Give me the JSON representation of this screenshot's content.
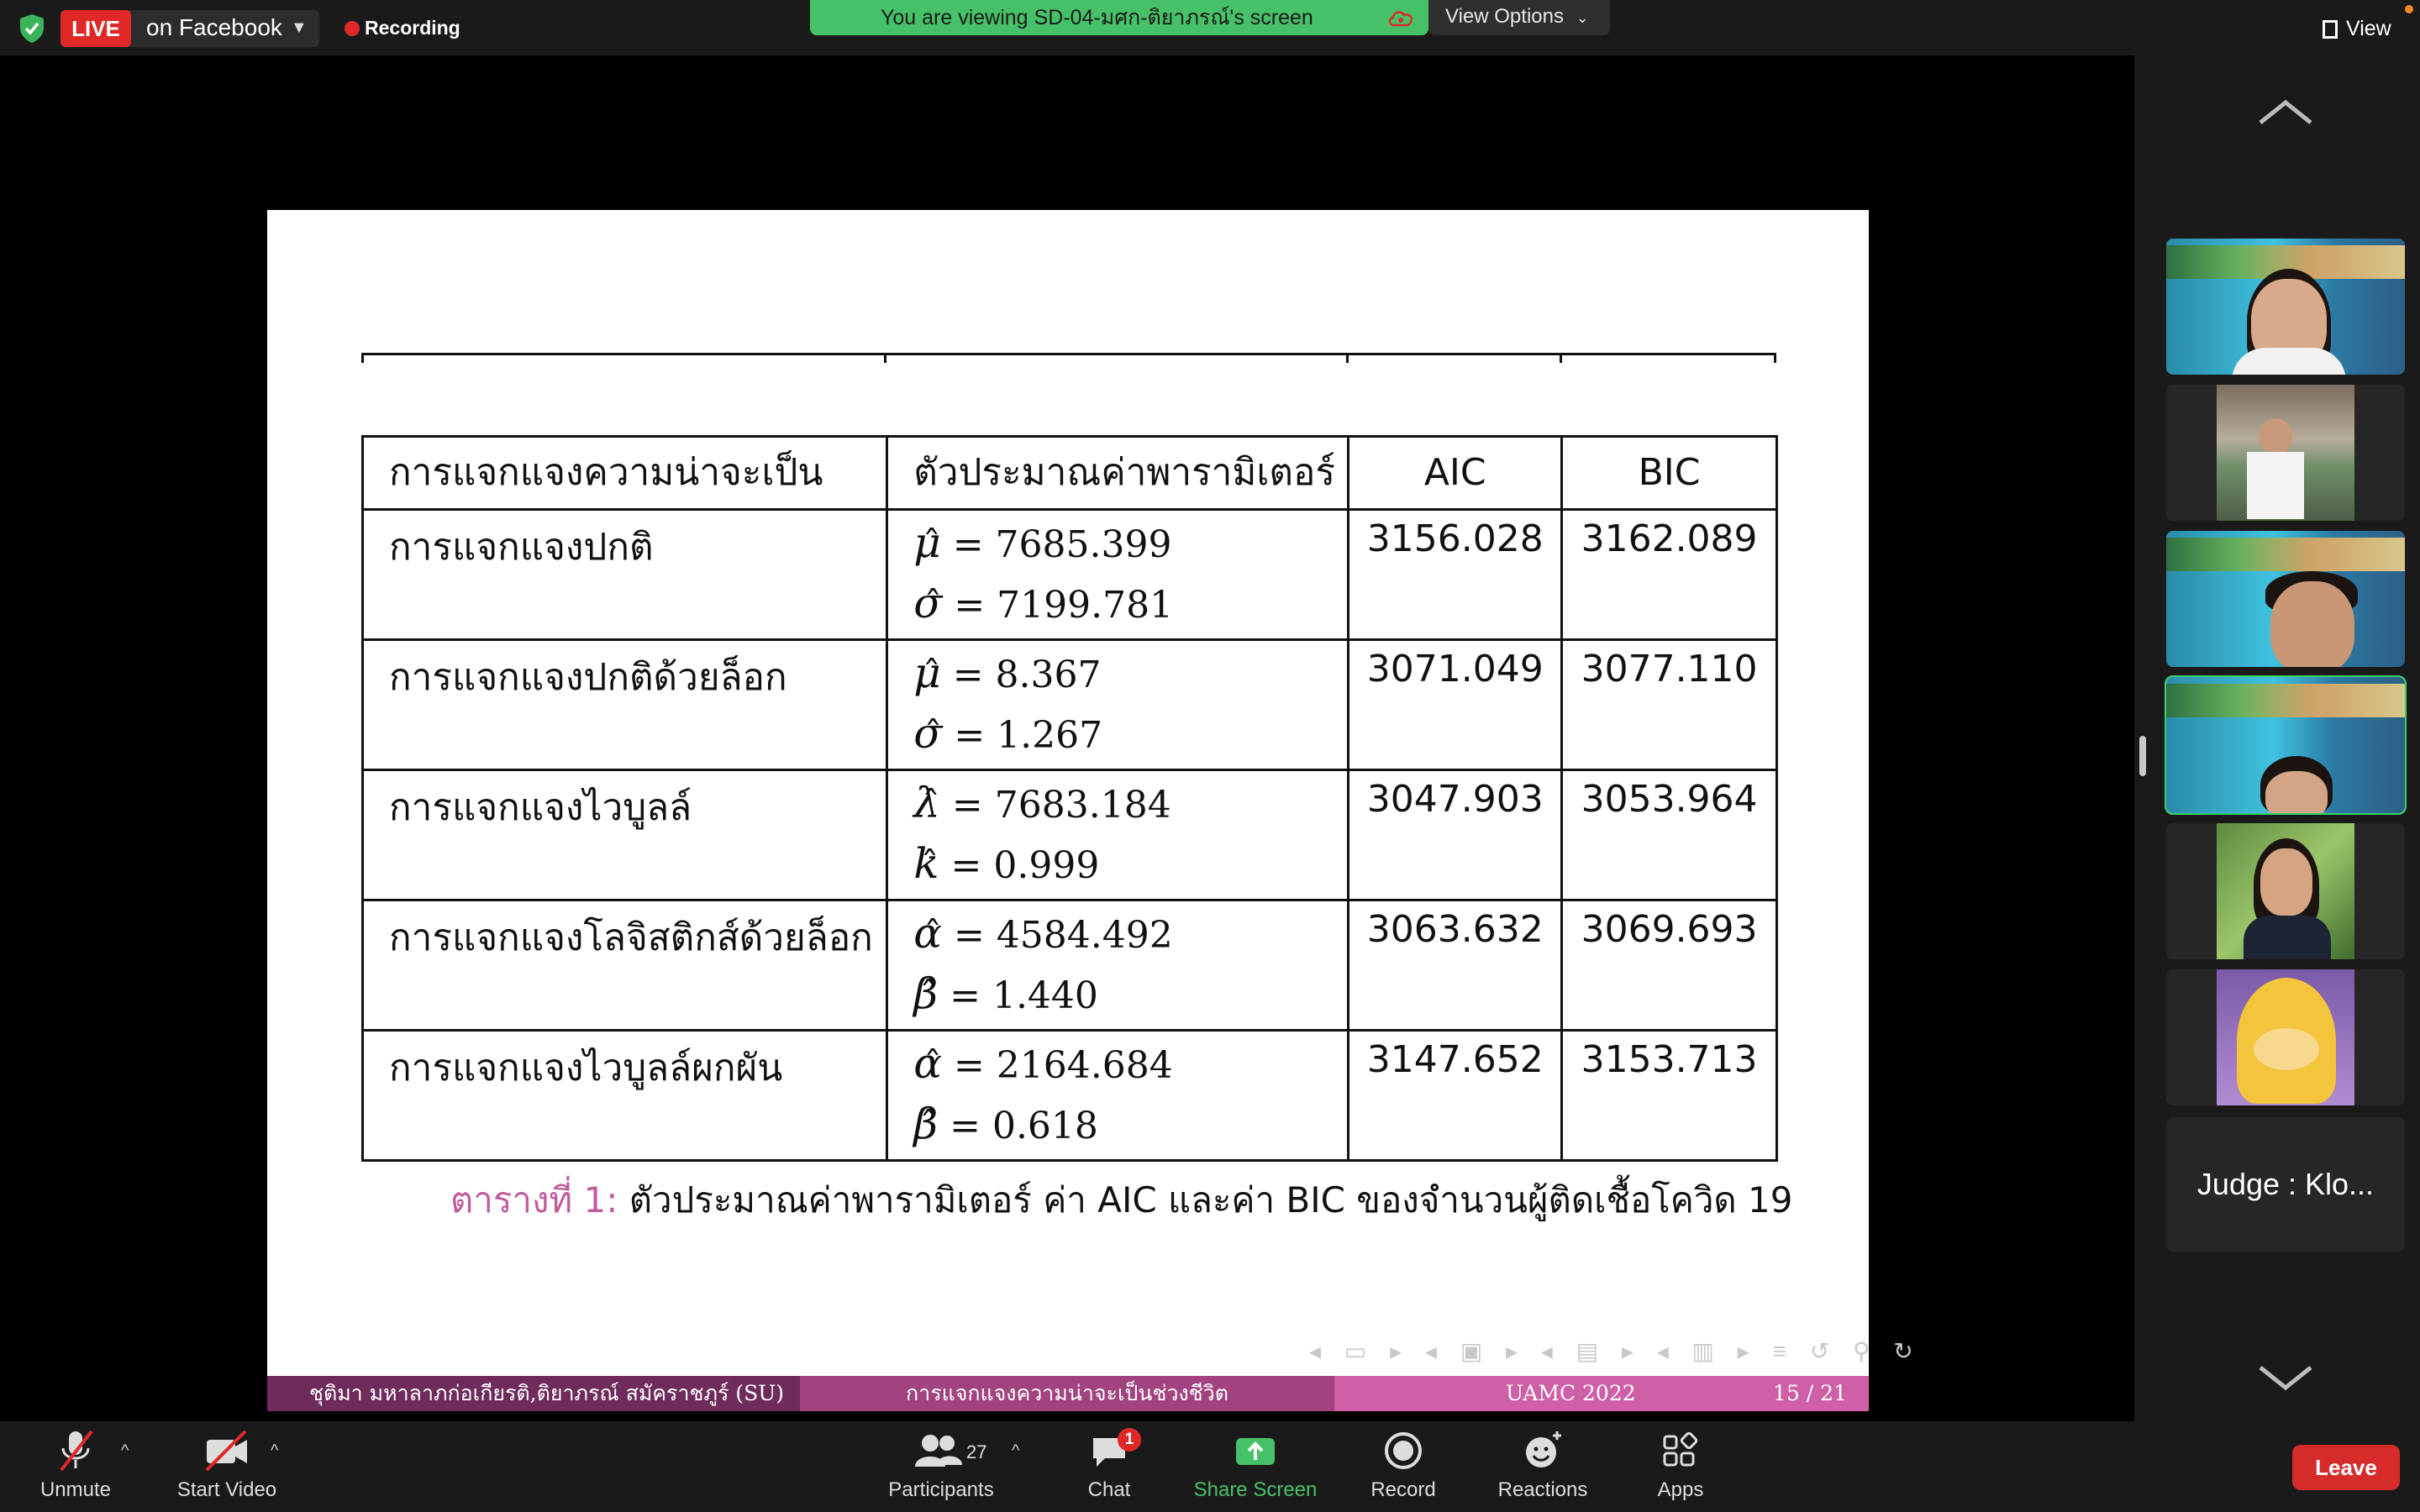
{
  "top_bar": {
    "live_label": "LIVE",
    "facebook_label": "on Facebook",
    "recording_label": "Recording",
    "viewing_banner": "You are viewing SD-04-มศก-ติยาภรณ์'s screen",
    "view_options_label": "View Options",
    "view_label": "View",
    "accent_green": "#46c168",
    "alert_red": "#e02828"
  },
  "slide": {
    "table": {
      "headers": [
        "การแจกแจงความน่าจะเป็น",
        "ตัวประมาณค่าพารามิเตอร์",
        "AIC",
        "BIC"
      ],
      "rows": [
        {
          "distribution": "การแจกแจงปกติ",
          "params": [
            {
              "symbol": "μ",
              "eq": "= 7685.399"
            },
            {
              "symbol": "σ",
              "eq": "= 7199.781"
            }
          ],
          "aic": "3156.028",
          "bic": "3162.089"
        },
        {
          "distribution": "การแจกแจงปกติด้วยล็อก",
          "params": [
            {
              "symbol": "μ",
              "eq": "= 8.367"
            },
            {
              "symbol": "σ",
              "eq": "= 1.267"
            }
          ],
          "aic": "3071.049",
          "bic": "3077.110"
        },
        {
          "distribution": "การแจกแจงไวบูลล์",
          "params": [
            {
              "symbol": "λ",
              "eq": "= 7683.184"
            },
            {
              "symbol": "k",
              "eq": "= 0.999"
            }
          ],
          "aic": "3047.903",
          "bic": "3053.964"
        },
        {
          "distribution": "การแจกแจงโลจิสติกส์ด้วยล็อก",
          "params": [
            {
              "symbol": "α",
              "eq": "= 4584.492"
            },
            {
              "symbol": "β",
              "eq": "= 1.440"
            }
          ],
          "aic": "3063.632",
          "bic": "3069.693"
        },
        {
          "distribution": "การแจกแจงไวบูลล์ผกผัน",
          "params": [
            {
              "symbol": "α",
              "eq": "= 2164.684"
            },
            {
              "symbol": "β",
              "eq": "= 0.618"
            }
          ],
          "aic": "3147.652",
          "bic": "3153.713"
        }
      ]
    },
    "caption_label": "ตารางที่ 1:",
    "caption_text": "ตัวประมาณค่าพารามิเตอร์ ค่า AIC และค่า BIC ของจำนวนผู้ติดเชื้อโควิด 19",
    "footer": {
      "authors": "ชุติมา มหาลาภก่อเกียรติ,ติยาภรณ์ สมัคราชภูร์ (SU)",
      "title": "การแจกแจงความน่าจะเป็นช่วงชีวิต",
      "conference": "UAMC 2022",
      "page": "15 / 21"
    },
    "caption_color": "#c25b9c"
  },
  "participants": {
    "judge_label": "Judge : Klo..."
  },
  "toolbar": {
    "unmute": "Unmute",
    "start_video": "Start Video",
    "participants": "Participants",
    "participant_count": "27",
    "chat": "Chat",
    "chat_badge": "1",
    "share_screen": "Share Screen",
    "record": "Record",
    "reactions": "Reactions",
    "apps": "Apps",
    "leave": "Leave"
  }
}
